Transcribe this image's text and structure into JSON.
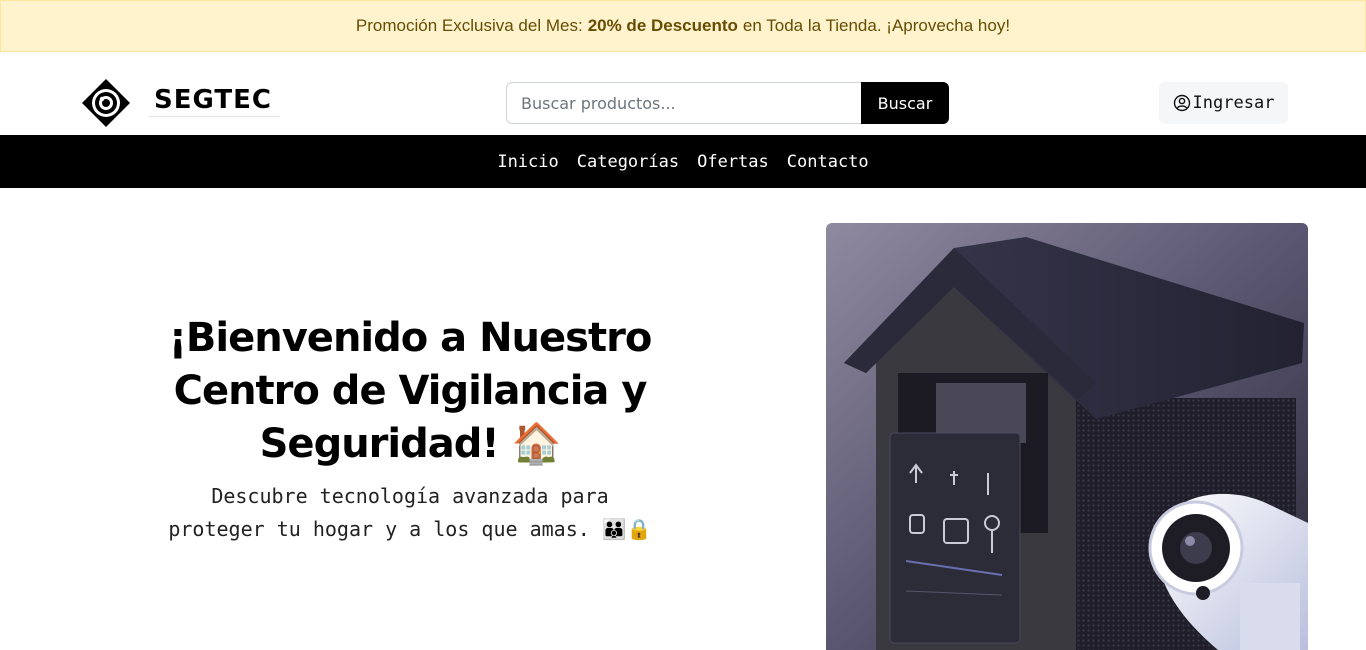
{
  "promo": {
    "prefix": "Promoción Exclusiva del Mes:",
    "highlight": "20% de Descuento",
    "suffix": "en Toda la Tienda. ¡Aprovecha hoy!"
  },
  "header": {
    "brand": "SEGTEC",
    "search_placeholder": "Buscar productos...",
    "search_button": "Buscar",
    "login_label": "Ingresar"
  },
  "nav": {
    "items": [
      "Inicio",
      "Categorías",
      "Ofertas",
      "Contacto"
    ]
  },
  "hero": {
    "title_line1": "¡Bienvenido a Nuestro",
    "title_line2": "Centro de Vigilancia y",
    "title_line3": "Seguridad!",
    "title_emoji": "🏠",
    "subtitle_line1": "Descubre tecnología avanzada para",
    "subtitle_line2": "proteger tu hogar y a los que amas.",
    "subtitle_emoji": "👪🔒"
  },
  "colors": {
    "promo_bg": "#fff3cd",
    "promo_text": "#664d03",
    "nav_bg": "#000000",
    "accent": "#000000"
  },
  "icons": {
    "logo": "eye-diamond-logo",
    "login": "user-circle-icon"
  }
}
